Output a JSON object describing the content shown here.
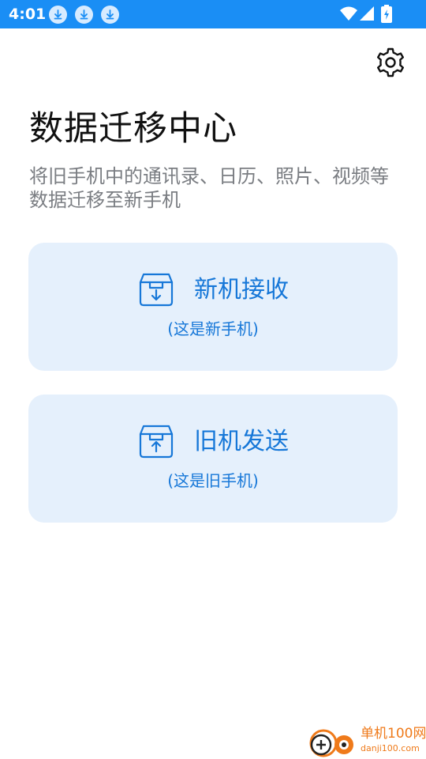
{
  "status_bar": {
    "time": "4:01",
    "notification_icons": [
      "download-icon",
      "download-icon",
      "download-icon"
    ],
    "system_icons": [
      "wifi-icon",
      "signal-icon",
      "battery-charging-icon"
    ],
    "background_color": "#1a8ef5"
  },
  "header": {
    "settings_icon": "gear-icon",
    "title": "数据迁移中心",
    "subtitle": "将旧手机中的通讯录、日历、照片、视频等数据迁移至新手机"
  },
  "options": [
    {
      "icon": "box-download-icon",
      "label": "新机接收",
      "hint": "(这是新手机)"
    },
    {
      "icon": "box-upload-icon",
      "label": "旧机发送",
      "hint": "(这是旧手机)"
    }
  ],
  "colors": {
    "accent": "#1677d8",
    "card_background": "#e5f0fc",
    "title": "#111111",
    "subtitle": "#7a7d82"
  },
  "watermark": {
    "name": "单机100网",
    "url": "danji100.com",
    "color": "#ef7a1a"
  }
}
